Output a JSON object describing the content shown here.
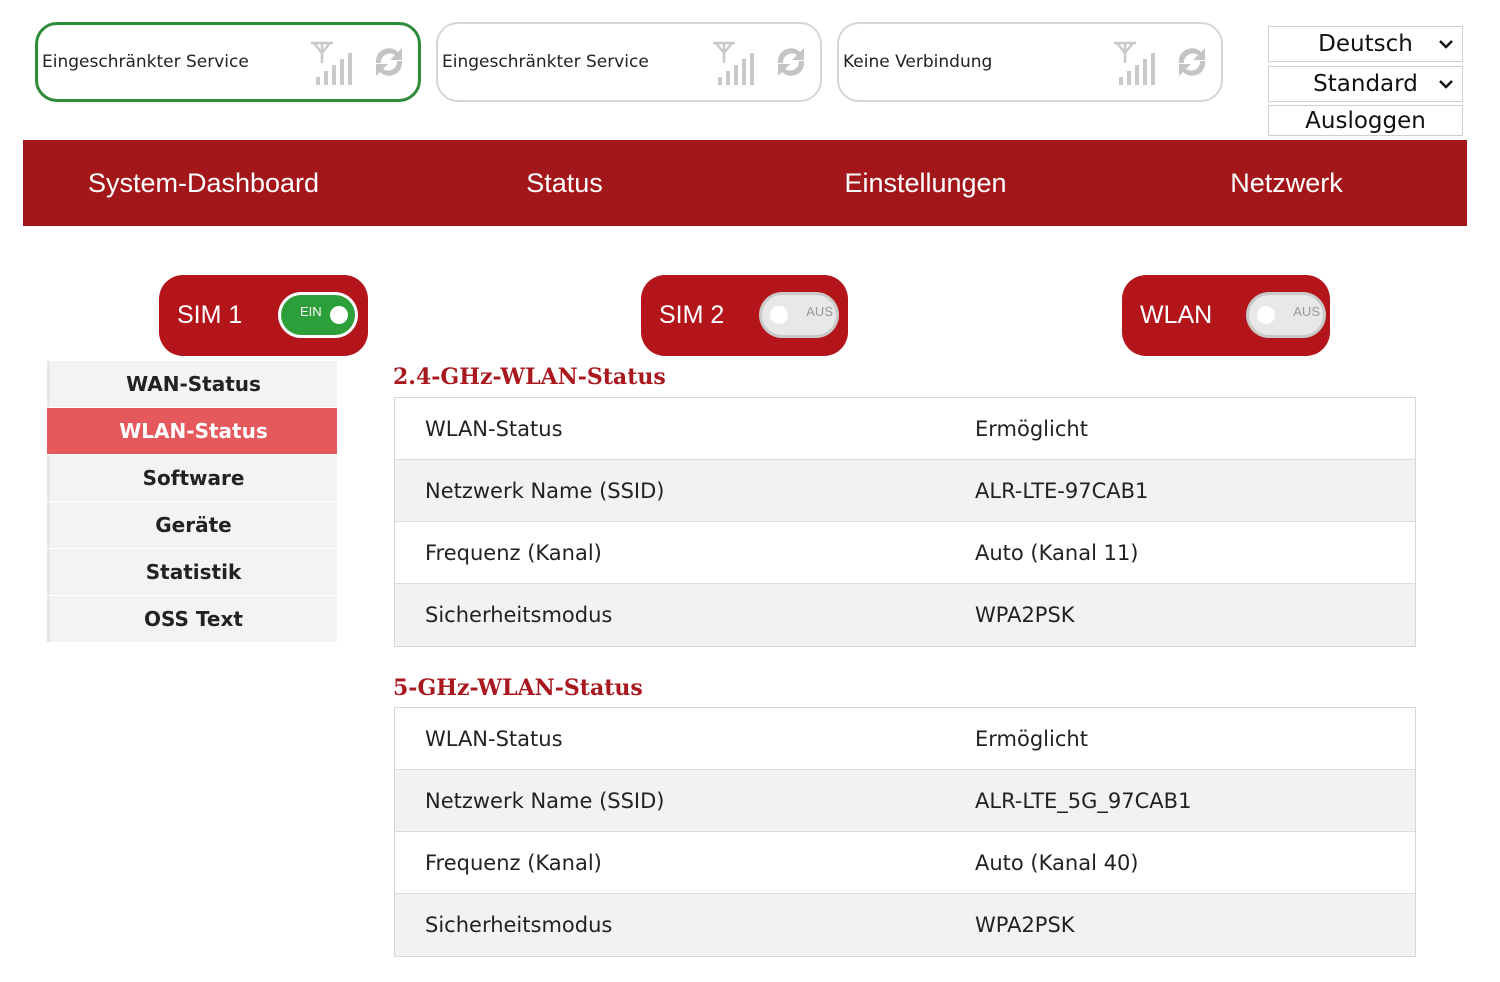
{
  "connections": [
    {
      "text": "Eingeschränkter Service",
      "active": true
    },
    {
      "text": "Eingeschränkter Service",
      "active": false
    },
    {
      "text": "Keine Verbindung",
      "active": false
    }
  ],
  "controls": {
    "language": "Deutsch",
    "profile": "Standard",
    "logout": "Ausloggen"
  },
  "nav": [
    "System-Dashboard",
    "Status",
    "Einstellungen",
    "Netzwerk"
  ],
  "toggles": [
    {
      "label": "SIM 1",
      "state": "EIN",
      "on": true
    },
    {
      "label": "SIM 2",
      "state": "AUS",
      "on": false
    },
    {
      "label": "WLAN",
      "state": "AUS",
      "on": false
    }
  ],
  "sidebar": [
    {
      "label": "WAN-Status",
      "active": false
    },
    {
      "label": "WLAN-Status",
      "active": true
    },
    {
      "label": "Software",
      "active": false
    },
    {
      "label": "Geräte",
      "active": false
    },
    {
      "label": "Statistik",
      "active": false
    },
    {
      "label": "OSS Text",
      "active": false
    }
  ],
  "sections": [
    {
      "title": "2.4-GHz-WLAN-Status",
      "rows": [
        {
          "key": "WLAN-Status",
          "value": "Ermöglicht"
        },
        {
          "key": "Netzwerk Name (SSID)",
          "value": "ALR-LTE-97CAB1"
        },
        {
          "key": "Frequenz (Kanal)",
          "value": "Auto (Kanal 11)"
        },
        {
          "key": "Sicherheitsmodus",
          "value": "WPA2PSK"
        }
      ]
    },
    {
      "title": "5-GHz-WLAN-Status",
      "rows": [
        {
          "key": "WLAN-Status",
          "value": "Ermöglicht"
        },
        {
          "key": "Netzwerk Name (SSID)",
          "value": "ALR-LTE_5G_97CAB1"
        },
        {
          "key": "Frequenz (Kanal)",
          "value": "Auto (Kanal 40)"
        },
        {
          "key": "Sicherheitsmodus",
          "value": "WPA2PSK"
        }
      ]
    }
  ],
  "colors": {
    "brand_red": "#a3171b",
    "active_item": "#e5585b",
    "switch_on": "#2c9e3a",
    "active_border": "#2e8b3a"
  },
  "icons": [
    "antenna-icon",
    "signal-bars-icon",
    "refresh-icon",
    "chevron-down-icon"
  ]
}
